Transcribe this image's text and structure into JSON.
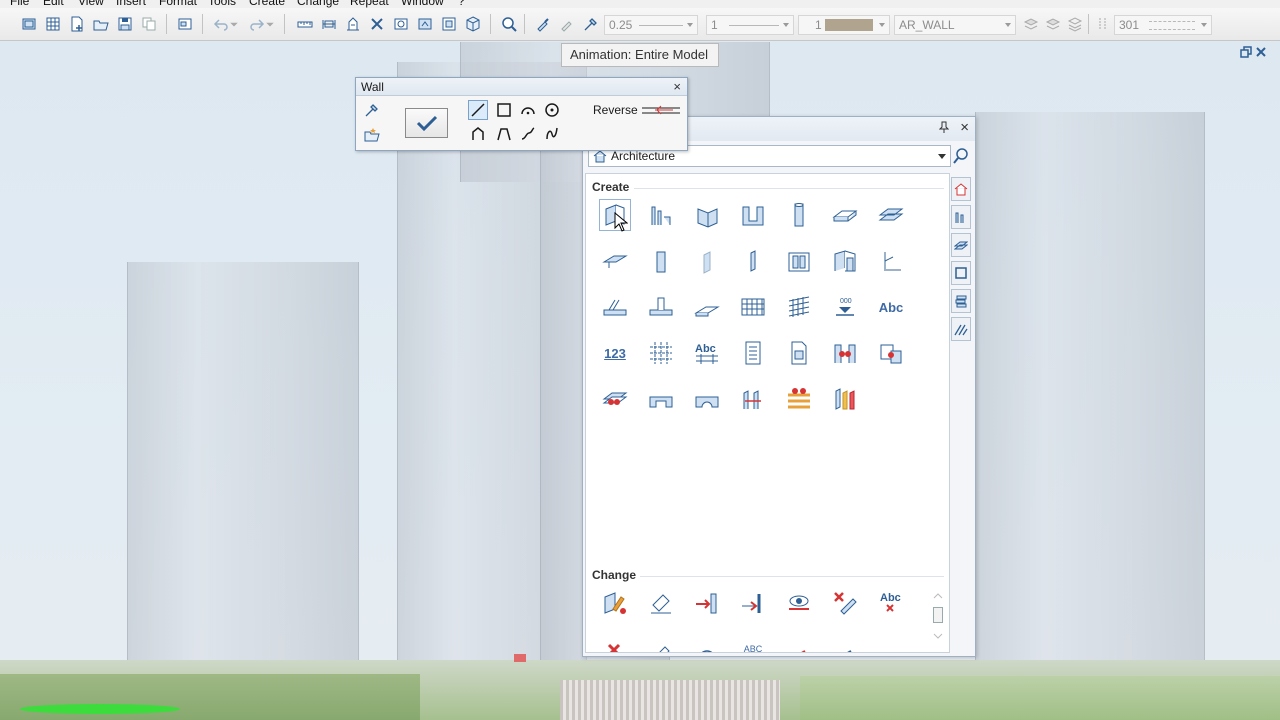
{
  "menu": [
    "File",
    "Edit",
    "View",
    "Insert",
    "Format",
    "Tools",
    "Create",
    "Change",
    "Repeat",
    "Window",
    "?"
  ],
  "toolbar": {
    "pen_thickness": "0.25",
    "line_type": "1",
    "color_index": "1",
    "layer": "AR_WALL",
    "hatch_number": "301"
  },
  "tooltip": "Animation: Entire Model",
  "wall_toolbar": {
    "title": "Wall",
    "reverse_label": "Reverse",
    "close_glyph": "×"
  },
  "palette": {
    "close_glyph": "×",
    "pin_glyph": "█",
    "category": "Architecture",
    "sections": {
      "create": "Create",
      "change": "Change"
    },
    "text_tools": {
      "abc": "Abc",
      "num": "123",
      "abc_small": "ABC"
    }
  },
  "colors": {
    "accent_blue": "#3e6aa5",
    "mark_red": "#d63434",
    "sky": "#dfe9f1"
  }
}
